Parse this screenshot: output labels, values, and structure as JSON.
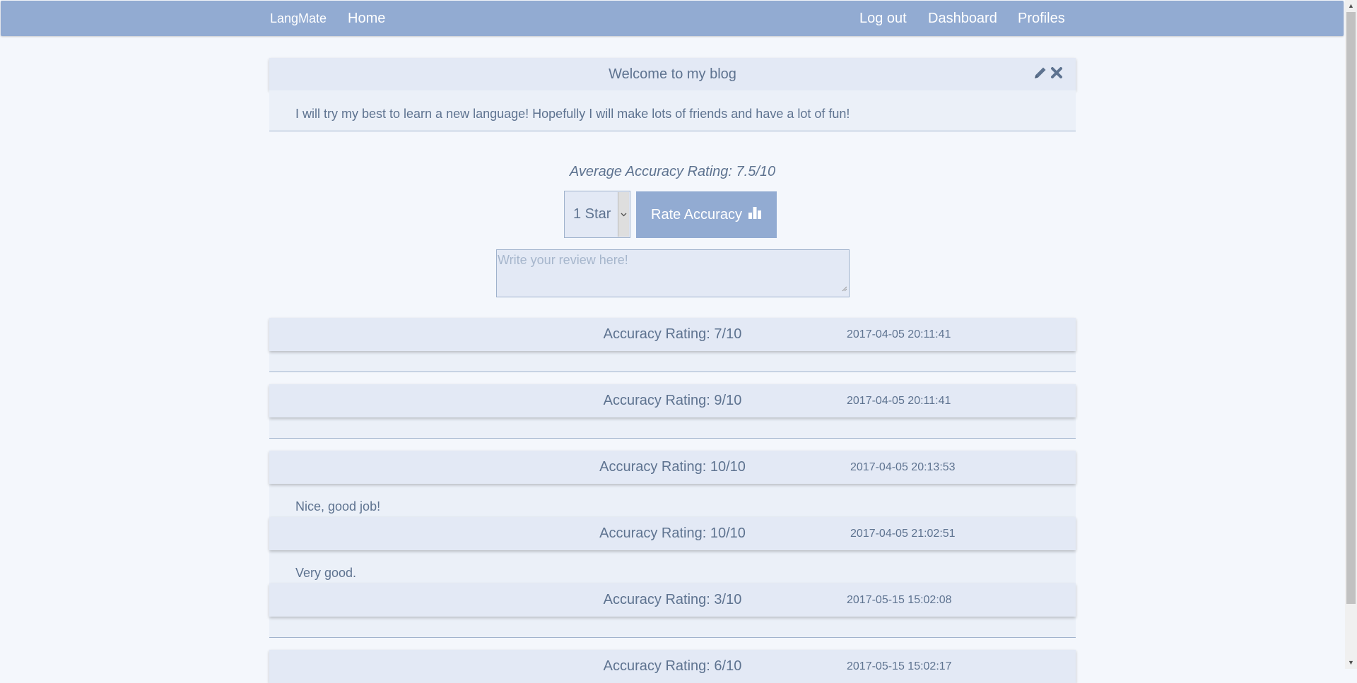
{
  "nav": {
    "brand": "LangMate",
    "home": "Home",
    "logout": "Log out",
    "dashboard": "Dashboard",
    "profiles": "Profiles"
  },
  "post": {
    "title": "Welcome to my blog",
    "body": "I will try my best to learn a new language! Hopefully I will make lots of friends and have a lot of fun!",
    "edit_icon": "pencil-icon",
    "delete_icon": "close-icon"
  },
  "rating_form": {
    "average": "Average Accuracy Rating: 7.5/10",
    "select_value": "1 Star",
    "button_label": "Rate Accuracy",
    "button_icon": "bar-chart-icon",
    "review_placeholder": "Write your review here!"
  },
  "reviews": [
    {
      "rating": "Accuracy Rating: 7/10",
      "date": "2017-04-05 20:11:41",
      "comment": ""
    },
    {
      "rating": "Accuracy Rating: 9/10",
      "date": "2017-04-05 20:11:41",
      "comment": ""
    },
    {
      "rating": "Accuracy Rating: 10/10",
      "date": "2017-04-05 20:13:53",
      "comment": "Nice, good job!"
    },
    {
      "rating": "Accuracy Rating: 10/10",
      "date": "2017-04-05 21:02:51",
      "comment": "Very good."
    },
    {
      "rating": "Accuracy Rating: 3/10",
      "date": "2017-05-15 15:02:08",
      "comment": ""
    },
    {
      "rating": "Accuracy Rating: 6/10",
      "date": "2017-05-15 15:02:17",
      "comment": ""
    }
  ],
  "colors": {
    "accent": "#92abd2",
    "background": "#f4f7fc",
    "card": "#e3e9f5",
    "text": "#5e7390"
  }
}
